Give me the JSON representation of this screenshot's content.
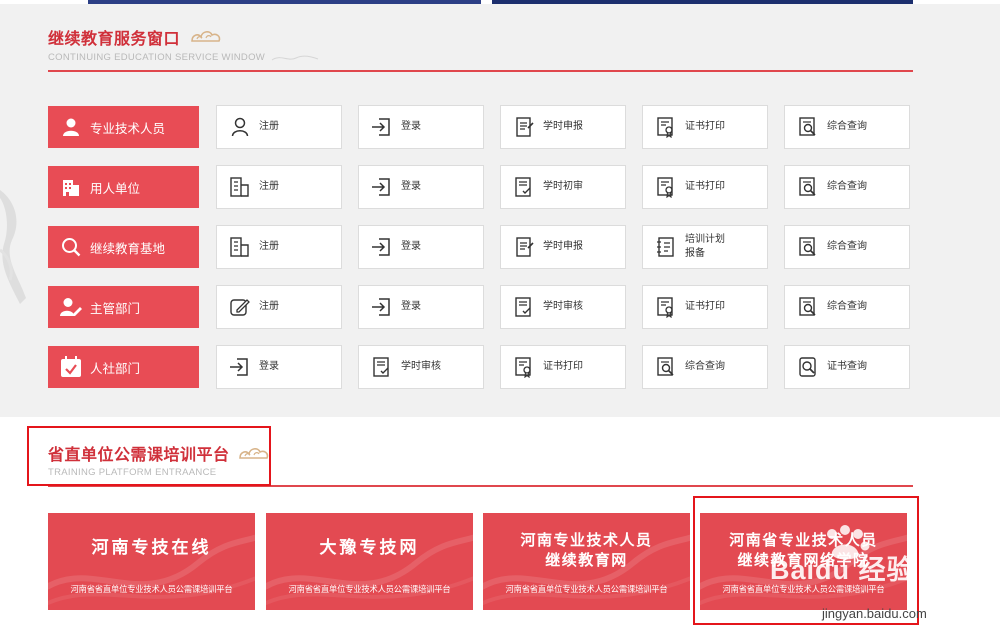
{
  "colors": {
    "accent": "#e84c55",
    "title_red": "#d0303a",
    "highlight": "#e4151b"
  },
  "service_section": {
    "title": "继续教育服务窗口",
    "subtitle": "CONTINUING EDUCATION SERVICE WINDOW"
  },
  "rows": [
    {
      "role": {
        "label": "专业技术人员",
        "icon": "person-icon"
      },
      "actions": [
        {
          "label": "注册",
          "icon": "user-outline-icon"
        },
        {
          "label": "登录",
          "icon": "login-arrow-icon"
        },
        {
          "label": "学时申报",
          "icon": "document-edit-icon"
        },
        {
          "label": "证书打印",
          "icon": "certificate-icon"
        },
        {
          "label": "综合查询",
          "icon": "search-document-icon"
        }
      ]
    },
    {
      "role": {
        "label": "用人单位",
        "icon": "building-icon"
      },
      "actions": [
        {
          "label": "注册",
          "icon": "building-outline-icon"
        },
        {
          "label": "登录",
          "icon": "login-arrow-icon"
        },
        {
          "label": "学时初审",
          "icon": "document-check-icon"
        },
        {
          "label": "证书打印",
          "icon": "certificate-icon"
        },
        {
          "label": "综合查询",
          "icon": "search-document-icon"
        }
      ]
    },
    {
      "role": {
        "label": "继续教育基地",
        "icon": "search-icon"
      },
      "actions": [
        {
          "label": "注册",
          "icon": "building-outline-icon"
        },
        {
          "label": "登录",
          "icon": "login-arrow-icon"
        },
        {
          "label": "学时申报",
          "icon": "document-edit-icon"
        },
        {
          "label": "培训计划\n报备",
          "icon": "plan-file-icon"
        },
        {
          "label": "综合查询",
          "icon": "search-document-icon"
        }
      ]
    },
    {
      "role": {
        "label": "主管部门",
        "icon": "user-edit-icon"
      },
      "actions": [
        {
          "label": "注册",
          "icon": "pencil-square-icon"
        },
        {
          "label": "登录",
          "icon": "login-arrow-icon"
        },
        {
          "label": "学时审核",
          "icon": "document-check-icon"
        },
        {
          "label": "证书打印",
          "icon": "certificate-icon"
        },
        {
          "label": "综合查询",
          "icon": "search-document-icon"
        }
      ]
    },
    {
      "role": {
        "label": "人社部门",
        "icon": "calendar-check-icon"
      },
      "actions": [
        {
          "label": "登录",
          "icon": "login-arrow-icon"
        },
        {
          "label": "学时审核",
          "icon": "document-check-icon"
        },
        {
          "label": "证书打印",
          "icon": "certificate-icon"
        },
        {
          "label": "综合查询",
          "icon": "search-document-icon"
        },
        {
          "label": "证书查询",
          "icon": "certificate-search-icon"
        }
      ]
    }
  ],
  "platform_section": {
    "title": "省直单位公需课培训平台",
    "subtitle": "TRAINING PLATFORM ENTRAANCE"
  },
  "platforms": [
    {
      "name": "河南专技在线",
      "name2": "",
      "sub": "河南省省直单位专业技术人员公需课培训平台"
    },
    {
      "name": "大豫专技网",
      "name2": "",
      "sub": "河南省省直单位专业技术人员公需课培训平台"
    },
    {
      "name": "河南专业技术人员",
      "name2": "继续教育网",
      "sub": "河南省省直单位专业技术人员公需课培训平台"
    },
    {
      "name": "河南省专业技术人员",
      "name2": "继续教育网络学院",
      "sub": "河南省省直单位专业技术人员公需课培训平台"
    }
  ],
  "watermark": {
    "logo": "Baidu 经验",
    "url": "jingyan.baidu.com"
  }
}
